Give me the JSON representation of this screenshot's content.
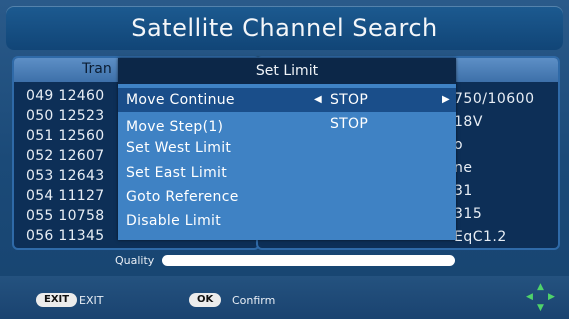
{
  "title": "Satellite Channel Search",
  "transponder_header": "Tran",
  "transponders": [
    "049 12460 ",
    "050 12523 ",
    "051 12560 ",
    "052 12607 ",
    "053 12643 ",
    "054 11127 ",
    "055 10758 ",
    "056 11345 "
  ],
  "info": [
    "750/10600",
    "18V",
    "o",
    "ne",
    "31",
    "315",
    "EqC1.2"
  ],
  "popup": {
    "title": "Set Limit",
    "items": [
      {
        "label": "Move Continue",
        "value": "STOP",
        "selected": true
      },
      {
        "label": "Move Step(1)",
        "value": "STOP",
        "selected": false
      },
      {
        "label": "Set West Limit",
        "value": "",
        "selected": false
      },
      {
        "label": "Set East Limit",
        "value": "",
        "selected": false
      },
      {
        "label": "Goto Reference",
        "value": "",
        "selected": false
      },
      {
        "label": "Disable Limit",
        "value": "",
        "selected": false
      }
    ]
  },
  "quality": {
    "label": "Quality",
    "level_percent": 0
  },
  "footer": {
    "exit_key": "EXIT",
    "exit_label": "EXIT",
    "ok_key": "OK",
    "ok_label": "Confirm"
  },
  "colors": {
    "background": "#1d4b78",
    "popup": "#3f82c4",
    "popup_selected": "#1a4e8a",
    "dpad": "#4fd36a"
  }
}
